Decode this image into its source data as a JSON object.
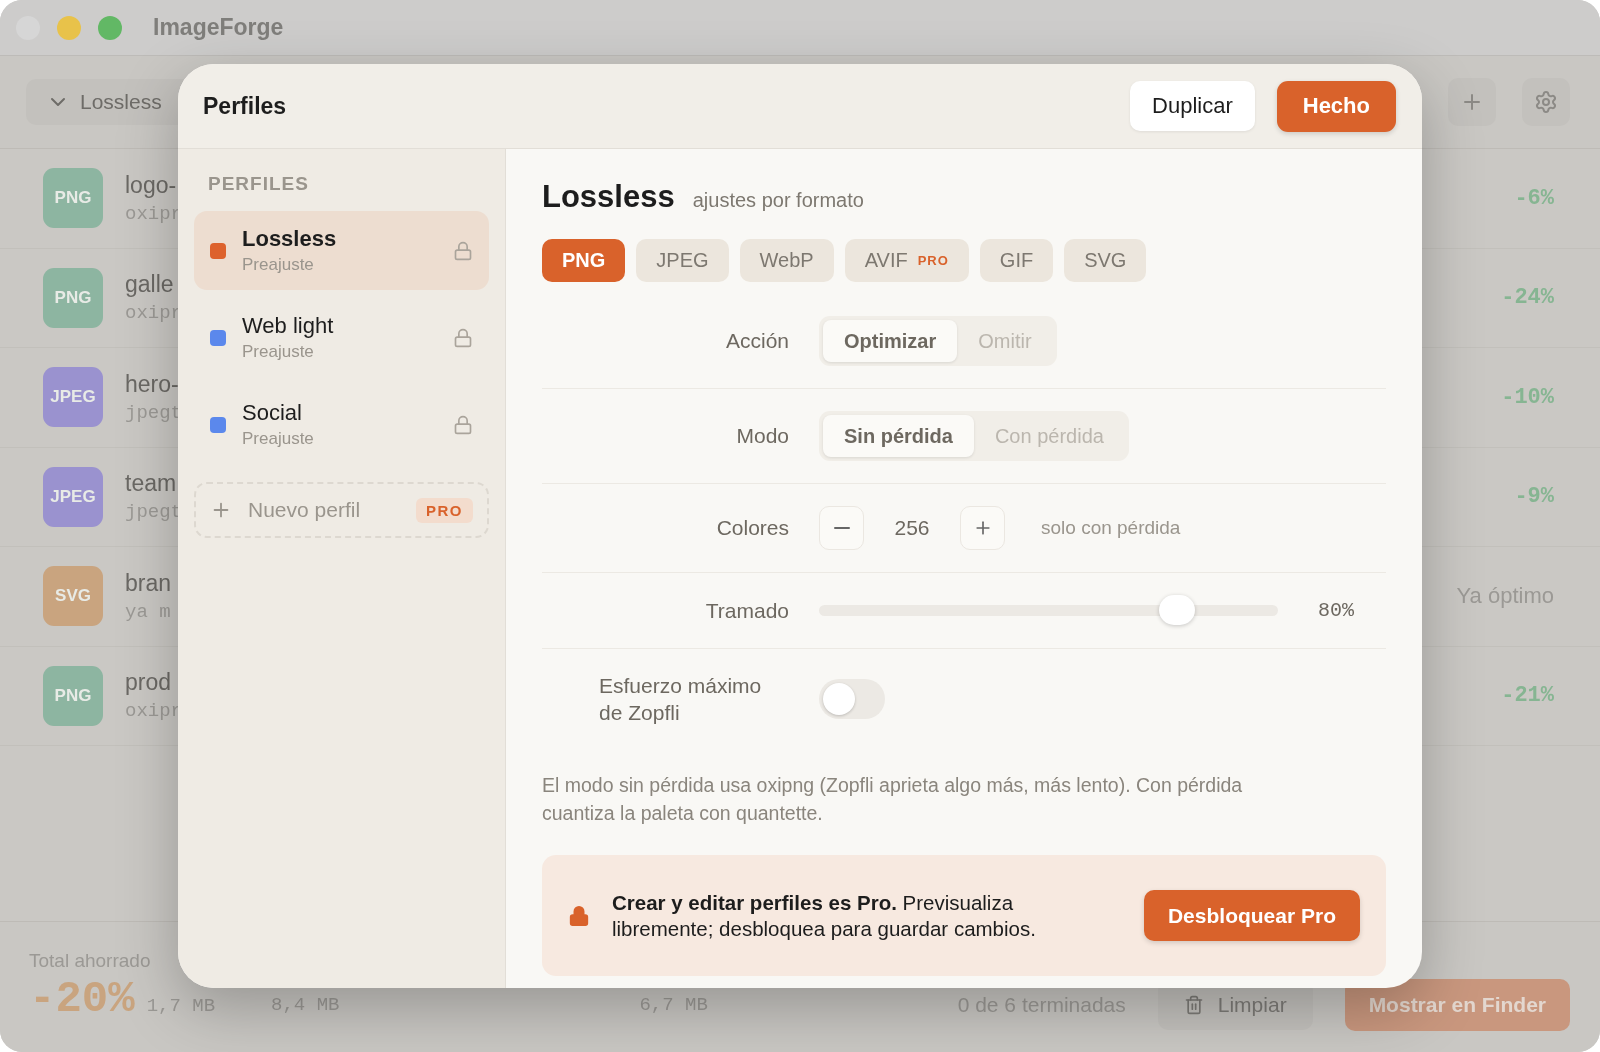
{
  "window": {
    "title": "ImageForge"
  },
  "toolbar": {
    "profile_dropdown": "Lossless"
  },
  "files": [
    {
      "badge": "PNG",
      "color": "#8db5a1",
      "name": "logo-",
      "detail": "oxipr",
      "result": "-6%",
      "kind": "saved"
    },
    {
      "badge": "PNG",
      "color": "#8db5a1",
      "name": "galle",
      "detail": "oxipr",
      "result": "-24%",
      "kind": "saved"
    },
    {
      "badge": "JPEG",
      "color": "#9a92cf",
      "name": "hero-",
      "detail": "jpegt",
      "result": "-10%",
      "kind": "saved"
    },
    {
      "badge": "JPEG",
      "color": "#9a92cf",
      "name": "team",
      "detail": "jpegt",
      "result": "-9%",
      "kind": "saved"
    },
    {
      "badge": "SVG",
      "color": "#c9a47f",
      "name": "bran",
      "detail": "ya m",
      "result": "Ya óptimo",
      "kind": "optimal"
    },
    {
      "badge": "PNG",
      "color": "#8db5a1",
      "name": "prod",
      "detail": "oxipr",
      "result": "-21%",
      "kind": "saved"
    }
  ],
  "footer": {
    "total_label": "Total ahorrado",
    "total_value": "-20%",
    "total_size": "1,7 MB",
    "original_size": "8,4 MB",
    "new_size": "6,7 MB",
    "progress": "0 de 6 terminadas",
    "clear_button": "Limpiar",
    "finder_button": "Mostrar en Finder"
  },
  "modal": {
    "title": "Perfiles",
    "duplicate_button": "Duplicar",
    "done_button": "Hecho",
    "sidebar_heading": "PERFILES",
    "profiles": [
      {
        "name": "Lossless",
        "subtitle": "Preajuste",
        "color": "#dd622d",
        "selected": true,
        "locked": true
      },
      {
        "name": "Web light",
        "subtitle": "Preajuste",
        "color": "#5b88ec",
        "selected": false,
        "locked": true
      },
      {
        "name": "Social",
        "subtitle": "Preajuste",
        "color": "#5b88ec",
        "selected": false,
        "locked": true
      }
    ],
    "new_profile": {
      "label": "Nuevo perfil",
      "badge": "PRO"
    },
    "editor": {
      "title": "Lossless",
      "subtitle": "ajustes por formato",
      "formats": [
        {
          "label": "PNG",
          "selected": true
        },
        {
          "label": "JPEG",
          "selected": false
        },
        {
          "label": "WebP",
          "selected": false
        },
        {
          "label": "AVIF",
          "badge": "PRO",
          "selected": false
        },
        {
          "label": "GIF",
          "selected": false
        },
        {
          "label": "SVG",
          "selected": false
        }
      ],
      "settings": [
        {
          "kind": "segmented",
          "label": "Acción",
          "options": [
            {
              "label": "Optimizar",
              "selected": true
            },
            {
              "label": "Omitir",
              "selected": false
            }
          ]
        },
        {
          "kind": "segmented",
          "label": "Modo",
          "options": [
            {
              "label": "Sin pérdida",
              "selected": true
            },
            {
              "label": "Con pérdida",
              "selected": false
            }
          ]
        },
        {
          "kind": "stepper",
          "label": "Colores",
          "value": "256",
          "hint": "solo con pérdida"
        },
        {
          "kind": "slider",
          "label": "Tramado",
          "level": 0.78,
          "reading": "80%"
        },
        {
          "kind": "toggle",
          "label": "Esfuerzo máximo de Zopfli",
          "on": false
        }
      ],
      "description": "El modo sin pérdida usa oxipng (Zopfli aprieta algo más, más lento). Con pérdida cuantiza la paleta con quantette.",
      "pro_banner": {
        "text": "**Crear y editar perfiles es Pro.** Previsualiza libremente; desbloquea para guardar cambios.",
        "button": "Desbloquear Pro"
      }
    }
  }
}
